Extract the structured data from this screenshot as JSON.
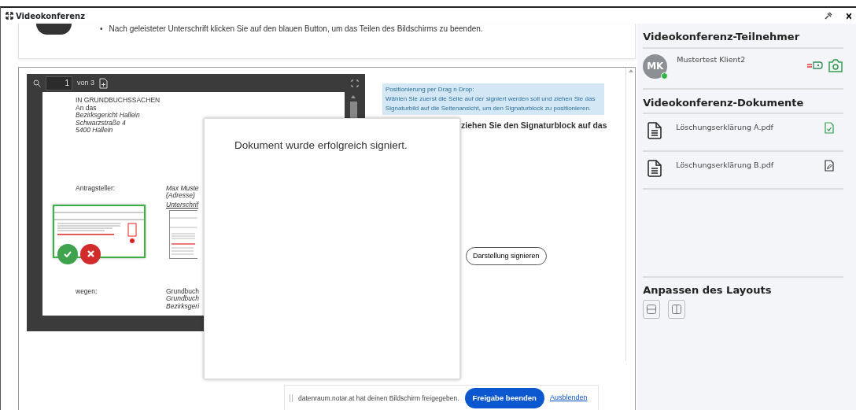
{
  "window": {
    "title": "Videokonferenz"
  },
  "instructions": [
    {
      "bullet": "•",
      "text": "Nach geleisteter Unterschrift klicken Sie auf den blauen Button, um das Teilen des Bildschirms zu beenden."
    }
  ],
  "pdf_viewer": {
    "page": "1",
    "page_count": "von 3",
    "address": [
      {
        "text": "IN GRUNDBUCHSSACHEN",
        "italic": false
      },
      {
        "text": "An das",
        "italic": false
      },
      {
        "text": "Bezirksgericht Hallein",
        "italic": true
      },
      {
        "text": "Schwarzstraße 4",
        "italic": true
      },
      {
        "text": "5400 Hallein",
        "italic": true
      }
    ],
    "applicant_label": "Antragsteller:",
    "applicant": [
      {
        "text": "Max Muste",
        "italic": true
      },
      {
        "text": "(Adresse)",
        "italic": true
      }
    ],
    "signature_label": "Unterschrif",
    "subject_label": "wegen:",
    "subject": [
      {
        "text": "Grundbuch",
        "italic": false
      },
      {
        "text": "Grundbuch",
        "italic": true
      },
      {
        "text": "Bezirksgeri",
        "italic": true
      }
    ]
  },
  "hint": {
    "title": "Positionierung per Drag n Drop:",
    "text": "Wählen Sie zuerst die Seite auf der signiert werden soll und ziehen Sie das Signaturbild auf die Seitenansicht, um den Signaturblock zu positionieren."
  },
  "instruction_partial": "ziehen Sie den Signaturblock auf das",
  "sign_button": "Darstellung signieren",
  "modal": {
    "message": "Dokument wurde erfolgreich signiert."
  },
  "sidebar": {
    "participants_title": "Videokonferenz-Teilnehmer",
    "participants": [
      {
        "initials": "MK",
        "name": "Mustertest Klient2",
        "online": true,
        "camera_on": true
      }
    ],
    "documents_title": "Videokonferenz-Dokumente",
    "documents": [
      {
        "name": "Löschungserklärung A.pdf",
        "signed": true
      },
      {
        "name": "Löschungserklärung B.pdf",
        "signed": false
      }
    ],
    "layout_title": "Anpassen des Layouts"
  },
  "share_bar": {
    "message": "datenraum.notar.at hat deinen Bildschirm freigegeben.",
    "stop_button": "Freigabe beenden",
    "hide_link": "Ausblenden"
  }
}
